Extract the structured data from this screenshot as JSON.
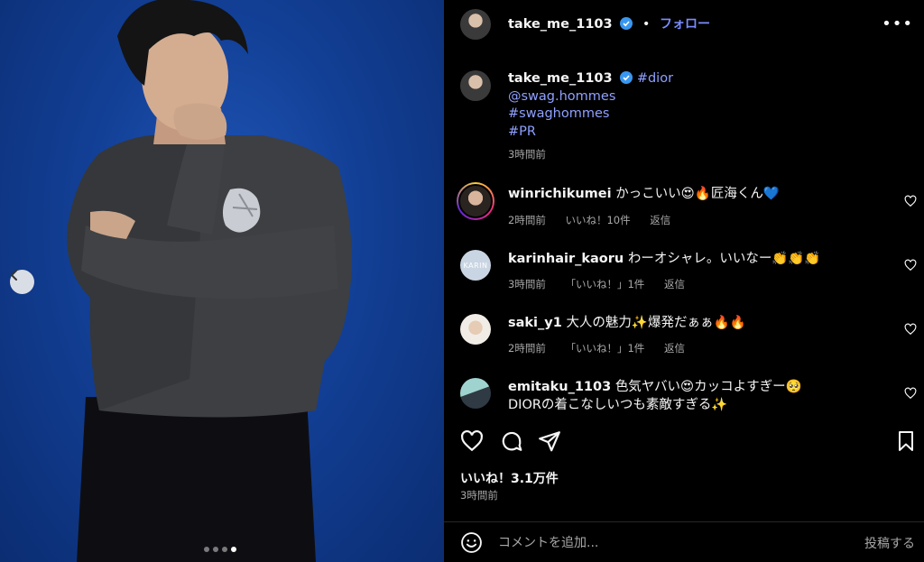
{
  "post": {
    "username": "take_me_1103",
    "follow_label": "フォロー",
    "separator": "•",
    "more_label": "•••"
  },
  "caption": {
    "username": "take_me_1103",
    "tags": [
      "#dior",
      "@swag.hommes",
      "#swaghommes",
      "#PR"
    ],
    "time": "3時間前"
  },
  "comments": [
    {
      "username": "winrichikumei",
      "text": "かっこいい😍🔥匠海くん💙",
      "time": "2時間前",
      "likes": "いいね！10件",
      "reply": "返信"
    },
    {
      "username": "karinhair_kaoru",
      "text": "わーオシャレ。いいなー👏👏👏",
      "time": "3時間前",
      "likes": "「いいね！」1件",
      "reply": "返信",
      "avatar_text": "KARIN"
    },
    {
      "username": "saki_y1",
      "text": "大人の魅力✨爆発だぁぁ🔥🔥",
      "time": "2時間前",
      "likes": "「いいね！」1件",
      "reply": "返信"
    },
    {
      "username": "emitaku_1103",
      "text": "色気ヤバい😍カッコよすぎー🥺",
      "text2": "DIORの着こなしいつも素敵すぎる✨"
    }
  ],
  "engagement": {
    "likes": "いいね！3.1万件",
    "time": "3時間前"
  },
  "comment_box": {
    "placeholder": "コメントを追加...",
    "post_label": "投稿する"
  },
  "carousel": {
    "total": 4,
    "active": 4
  },
  "colors": {
    "accent": "#7b8cff",
    "verified": "#3897f0",
    "background": "#000000",
    "photo_bg": "#1a4aa8"
  }
}
